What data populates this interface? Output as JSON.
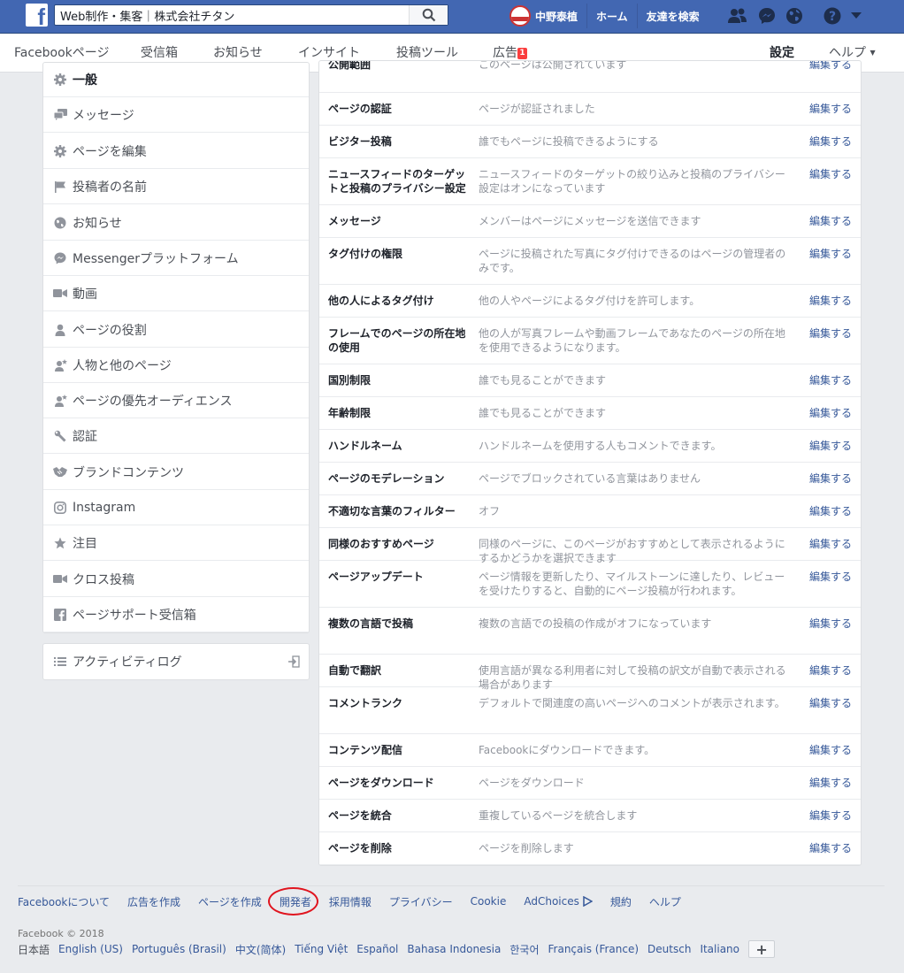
{
  "topbar": {
    "logo": "f",
    "search_value": "Web制作・集客｜株式会社チタン",
    "user_name": "中野泰植",
    "home": "ホーム",
    "find_friends": "友達を検索",
    "icons": [
      "friend-requests-icon",
      "messenger-icon",
      "notifications-globe-icon",
      "help-icon",
      "account-menu-caret-icon"
    ]
  },
  "pagenav": {
    "tabs": [
      "Facebookページ",
      "受信箱",
      "お知らせ",
      "インサイト",
      "投稿ツール",
      "広告"
    ],
    "ads_badge": "1",
    "settings": "設定",
    "help": "ヘルプ"
  },
  "leftmenu": {
    "items": [
      {
        "label": "一般",
        "icon": "gear-icon"
      },
      {
        "label": "メッセージ",
        "icon": "chat-bubbles-icon"
      },
      {
        "label": "ページを編集",
        "icon": "gear-icon"
      },
      {
        "label": "投稿者の名前",
        "icon": "flag-icon"
      },
      {
        "label": "お知らせ",
        "icon": "globe-icon"
      },
      {
        "label": "Messengerプラットフォーム",
        "icon": "messenger-icon"
      },
      {
        "label": "動画",
        "icon": "video-camera-icon"
      },
      {
        "label": "ページの役割",
        "icon": "person-icon"
      },
      {
        "label": "人物と他のページ",
        "icon": "person-star-icon"
      },
      {
        "label": "ページの優先オーディエンス",
        "icon": "person-star-icon"
      },
      {
        "label": "認証",
        "icon": "wrench-icon"
      },
      {
        "label": "ブランドコンテンツ",
        "icon": "handshake-icon"
      },
      {
        "label": "Instagram",
        "icon": "instagram-icon"
      },
      {
        "label": "注目",
        "icon": "star-icon"
      },
      {
        "label": "クロス投稿",
        "icon": "video-camera-icon"
      },
      {
        "label": "ページサポート受信箱",
        "icon": "facebook-square-icon"
      }
    ],
    "activity_log": "アクティビティログ"
  },
  "settings": {
    "edit_label": "編集する",
    "rows": [
      {
        "name": "公開範囲",
        "desc": "このページは公開されています"
      },
      {
        "name": "ページの認証",
        "desc": "ページが認証されました"
      },
      {
        "name": "ビジター投稿",
        "desc": "誰でもページに投稿できるようにする"
      },
      {
        "name": "ニュースフィードのターゲットと投稿のプライバシー設定",
        "desc": "ニュースフィードのターゲットの絞り込みと投稿のプライバシー設定はオンになっています"
      },
      {
        "name": "メッセージ",
        "desc": "メンバーはページにメッセージを送信できます"
      },
      {
        "name": "タグ付けの権限",
        "desc": "ページに投稿された写真にタグ付けできるのはページの管理者のみです。"
      },
      {
        "name": "他の人によるタグ付け",
        "desc": "他の人やページによるタグ付けを許可します。"
      },
      {
        "name": "フレームでのページの所在地の使用",
        "desc": "他の人が写真フレームや動画フレームであなたのページの所在地を使用できるようになります。"
      },
      {
        "name": "国別制限",
        "desc": "誰でも見ることができます"
      },
      {
        "name": "年齢制限",
        "desc": "誰でも見ることができます"
      },
      {
        "name": "ハンドルネーム",
        "desc": "ハンドルネームを使用する人もコメントできます。"
      },
      {
        "name": "ページのモデレーション",
        "desc": "ページでブロックされている言葉はありません"
      },
      {
        "name": "不適切な言葉のフィルター",
        "desc": "オフ"
      },
      {
        "name": "同様のおすすめページ",
        "desc": "同様のページに、このページがおすすめとして表示されるようにするかどうかを選択できます"
      },
      {
        "name": "ページアップデート",
        "desc": "ページ情報を更新したり、マイルストーンに達したり、レビューを受けたりすると、自動的にページ投稿が行われます。"
      },
      {
        "name": "複数の言語で投稿",
        "desc": "複数の言語での投稿の作成がオフになっています"
      },
      {
        "name": "自動で翻訳",
        "desc": "使用言語が異なる利用者に対して投稿の訳文が自動で表示される場合があります"
      },
      {
        "name": "コメントランク",
        "desc": "デフォルトで関連度の高いページへのコメントが表示されます。"
      },
      {
        "name": "コンテンツ配信",
        "desc": "Facebookにダウンロードできます。"
      },
      {
        "name": "ページをダウンロード",
        "desc": "ページをダウンロード"
      },
      {
        "name": "ページを統合",
        "desc": "重複しているページを統合します"
      },
      {
        "name": "ページを削除",
        "desc": "ページを削除します"
      }
    ]
  },
  "footer": {
    "links": [
      "Facebookについて",
      "広告を作成",
      "ページを作成",
      "開発者",
      "採用情報",
      "プライバシー",
      "Cookie",
      "AdChoices",
      "規約",
      "ヘルプ"
    ],
    "copyright": "Facebook © 2018",
    "languages": [
      "日本語",
      "English (US)",
      "Português (Brasil)",
      "中文(简体)",
      "Tiếng Việt",
      "Español",
      "Bahasa Indonesia",
      "한국어",
      "Français (France)",
      "Deutsch",
      "Italiano"
    ],
    "plus": "+"
  },
  "colors": {
    "brand_blue": "#4267b2",
    "link_blue": "#365899",
    "highlight_circle": "#e0141e",
    "badge_red": "#fa3e3e"
  }
}
